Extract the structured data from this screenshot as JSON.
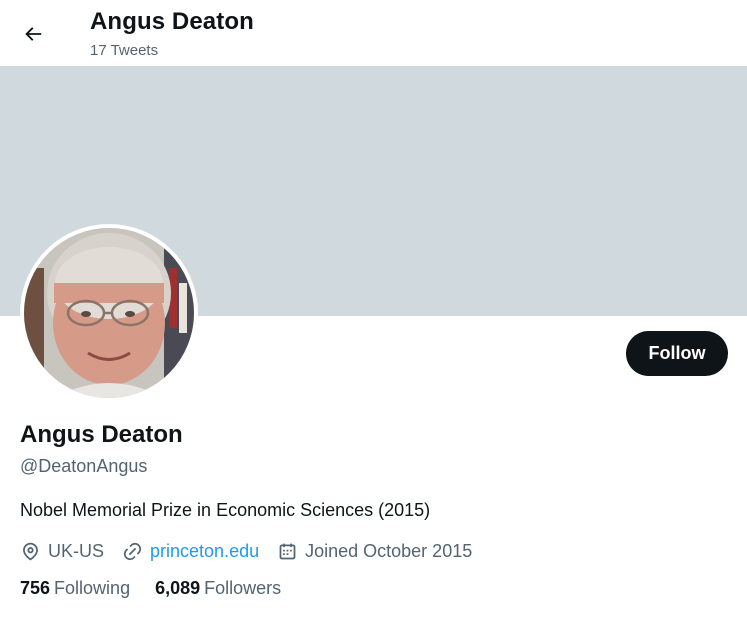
{
  "header": {
    "title": "Angus Deaton",
    "subtitle": "17 Tweets",
    "back_icon": "arrow-left-icon"
  },
  "colors": {
    "banner": "#cfd9de",
    "follow_button_bg": "#0f1419",
    "link": "#1d9bf0",
    "secondary_text": "#536471"
  },
  "profile": {
    "display_name": "Angus Deaton",
    "handle": "@DeatonAngus",
    "bio": "Nobel Memorial Prize in Economic Sciences (2015)",
    "follow_label": "Follow",
    "location": "UK-US",
    "location_icon": "location-pin-icon",
    "website": "princeton.edu",
    "website_icon": "link-icon",
    "joined": "Joined October 2015",
    "joined_icon": "calendar-icon"
  },
  "stats": {
    "following_count": "756",
    "following_label": "Following",
    "followers_count": "6,089",
    "followers_label": "Followers"
  }
}
